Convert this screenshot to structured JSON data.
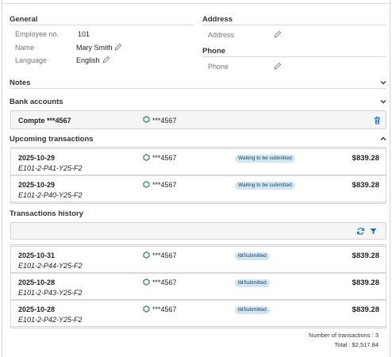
{
  "general": {
    "title": "General",
    "employee_no_label": "Employee no.",
    "employee_no": "101",
    "name_label": "Name",
    "name": "Mary Smith",
    "language_label": "Language",
    "language": "English"
  },
  "address": {
    "title": "Address",
    "label": "Address"
  },
  "phone": {
    "title": "Phone",
    "label": "Phone"
  },
  "notes": {
    "title": "Notes"
  },
  "bank_accounts": {
    "title": "Bank accounts",
    "account_name": "Compte ***4567",
    "account_mask": "***4567"
  },
  "upcoming": {
    "title": "Upcoming transactions",
    "rows": [
      {
        "date": "2025-10-29",
        "ref": "E101-2-P41-Y25-F2",
        "account": "***4567",
        "status": "Waiting to be submitted",
        "amount": "$839.28"
      },
      {
        "date": "2025-10-29",
        "ref": "E101-2-P40-Y25-F2",
        "account": "***4567",
        "status": "Waiting to be submitted",
        "amount": "$839.28"
      }
    ]
  },
  "history": {
    "title": "Transactions history",
    "rows": [
      {
        "date": "2025-10-31",
        "ref": "E101-2-P44-Y25-F2",
        "account": "***4567",
        "status": "lblSubmitted",
        "amount": "$839.28"
      },
      {
        "date": "2025-10-28",
        "ref": "E101-2-P43-Y25-F2",
        "account": "***4567",
        "status": "lblSubmitted",
        "amount": "$839.28"
      },
      {
        "date": "2025-10-28",
        "ref": "E101-2-P42-Y25-F2",
        "account": "***4567",
        "status": "lblSubmitted",
        "amount": "$839.28"
      }
    ],
    "count_text": "Number of transactions : 3",
    "total_text": "Total : $2,517.84"
  },
  "colors": {
    "accent": "#1a73b8",
    "hex_icon": "#2e8b57",
    "badge_bg": "#cfe6f4"
  }
}
